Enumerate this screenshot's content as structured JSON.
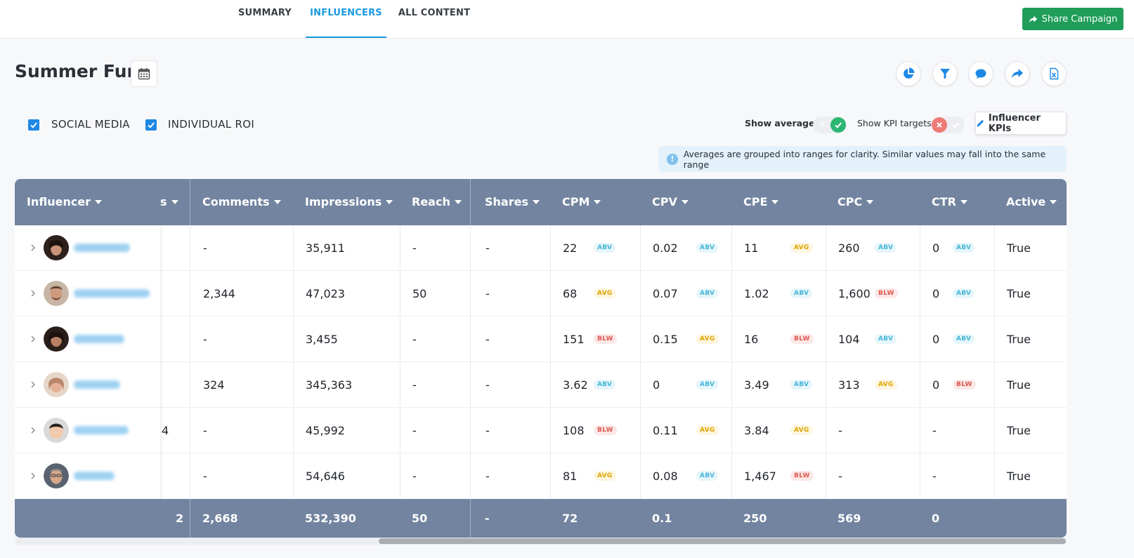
{
  "tabs": [
    {
      "label": "SUMMARY",
      "active": false
    },
    {
      "label": "INFLUENCERS",
      "active": true
    },
    {
      "label": "ALL CONTENT",
      "active": false
    }
  ],
  "share_button": {
    "label": "Share Campaign",
    "icon": "share-arrow-icon",
    "color": "#1f9d59"
  },
  "title": "Summer Fun",
  "toolbar_icons": [
    "pie-chart-icon",
    "filter-icon",
    "comment-icon",
    "share-icon",
    "excel-export-icon"
  ],
  "filters": [
    {
      "label": "SOCIAL MEDIA",
      "checked": true
    },
    {
      "label": "INDIVIDUAL ROI",
      "checked": true
    }
  ],
  "toggles": {
    "show_averages": {
      "label": "Show averages",
      "on": true
    },
    "show_kpi_targets": {
      "label": "Show KPI targets",
      "on": false
    }
  },
  "kpi_button": {
    "label": "Influencer KPIs",
    "icon": "pencil-icon"
  },
  "info_message": "Averages are grouped into ranges for clarity. Similar values may fall into the same range",
  "table": {
    "columns": [
      "Influencer",
      "s",
      "Comments",
      "Impressions",
      "Reach",
      "Shares",
      "CPM",
      "CPV",
      "CPE",
      "CPC",
      "CTR",
      "Active"
    ],
    "rows": [
      {
        "partial": "",
        "comments": "-",
        "impressions": "35,911",
        "reach": "-",
        "shares": "-",
        "cpm": "22",
        "cpm_b": "ABV",
        "cpv": "0.02",
        "cpv_b": "ABV",
        "cpe": "11",
        "cpe_b": "AVG",
        "cpc": "260",
        "cpc_b": "ABV",
        "ctr": "0",
        "ctr_b": "ABV",
        "active": "True"
      },
      {
        "partial": "",
        "comments": "2,344",
        "impressions": "47,023",
        "reach": "50",
        "shares": "-",
        "cpm": "68",
        "cpm_b": "AVG",
        "cpv": "0.07",
        "cpv_b": "ABV",
        "cpe": "1.02",
        "cpe_b": "ABV",
        "cpc": "1,600",
        "cpc_b": "BLW",
        "ctr": "0",
        "ctr_b": "ABV",
        "active": "True"
      },
      {
        "partial": "",
        "comments": "-",
        "impressions": "3,455",
        "reach": "-",
        "shares": "-",
        "cpm": "151",
        "cpm_b": "BLW",
        "cpv": "0.15",
        "cpv_b": "AVG",
        "cpe": "16",
        "cpe_b": "BLW",
        "cpc": "104",
        "cpc_b": "ABV",
        "ctr": "0",
        "ctr_b": "ABV",
        "active": "True"
      },
      {
        "partial": "",
        "comments": "324",
        "impressions": "345,363",
        "reach": "-",
        "shares": "-",
        "cpm": "3.62",
        "cpm_b": "ABV",
        "cpv": "0",
        "cpv_b": "ABV",
        "cpe": "3.49",
        "cpe_b": "ABV",
        "cpc": "313",
        "cpc_b": "AVG",
        "ctr": "0",
        "ctr_b": "BLW",
        "active": "True"
      },
      {
        "partial": "4",
        "comments": "-",
        "impressions": "45,992",
        "reach": "-",
        "shares": "-",
        "cpm": "108",
        "cpm_b": "BLW",
        "cpv": "0.11",
        "cpv_b": "AVG",
        "cpe": "3.84",
        "cpe_b": "AVG",
        "cpc": "-",
        "cpc_b": "",
        "ctr": "-",
        "ctr_b": "",
        "active": "True"
      },
      {
        "partial": "",
        "comments": "-",
        "impressions": "54,646",
        "reach": "-",
        "shares": "-",
        "cpm": "81",
        "cpm_b": "AVG",
        "cpv": "0.08",
        "cpv_b": "ABV",
        "cpe": "1,467",
        "cpe_b": "BLW",
        "cpc": "-",
        "cpc_b": "",
        "ctr": "-",
        "ctr_b": "",
        "active": "True"
      }
    ],
    "totals": {
      "partial": "2",
      "comments": "2,668",
      "impressions": "532,390",
      "reach": "50",
      "shares": "-",
      "cpm": "72",
      "cpv": "0.1",
      "cpe": "250",
      "cpc": "569",
      "ctr": "0"
    }
  },
  "badge_colors": {
    "ABV": "#46b6d8",
    "AVG": "#e0a400",
    "BLW": "#e0574f"
  }
}
